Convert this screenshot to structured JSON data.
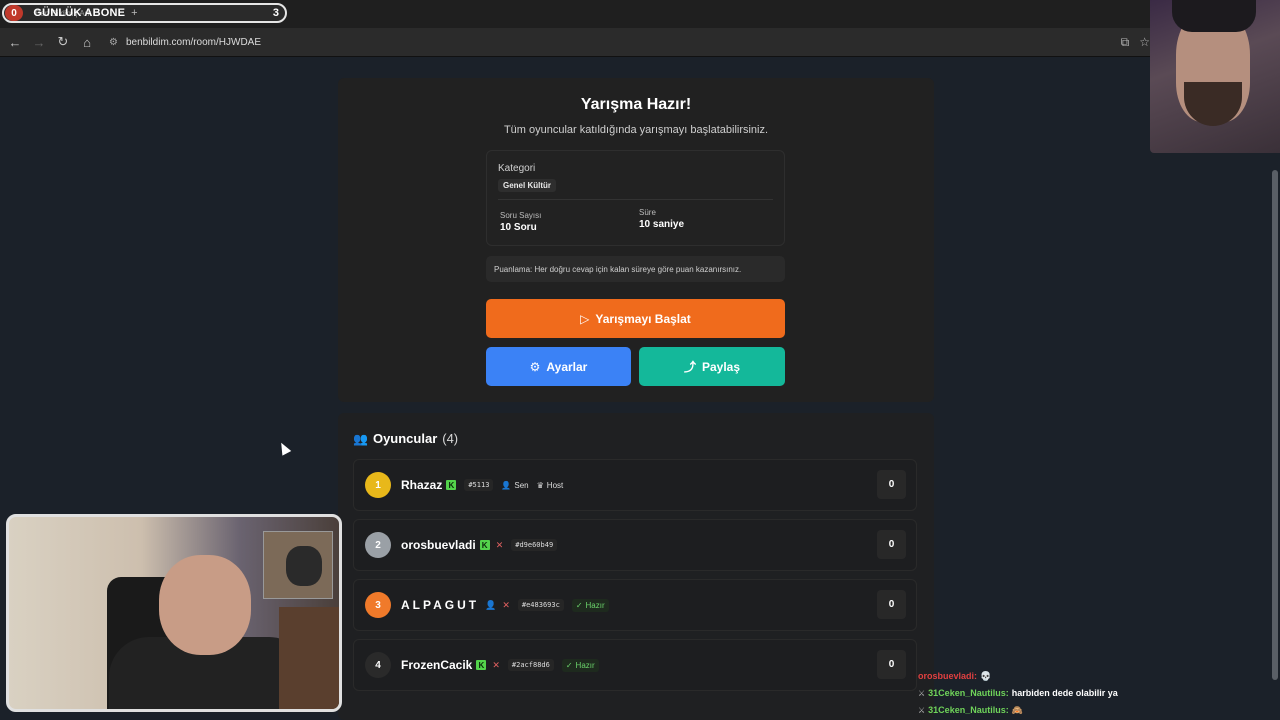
{
  "browser": {
    "tab_title": "Ben Bildim | Ark",
    "counter_left": "0",
    "counter_label": "GÜNLÜK ABONE",
    "counter_plus": "+",
    "counter_right": "3",
    "url": "benbildim.com/room/HJWDAE"
  },
  "ready": {
    "title": "Yarışma Hazır!",
    "subtitle": "Tüm oyuncular katıldığında yarışmayı başlatabilirsiniz.",
    "category_label": "Kategori",
    "category_value": "Genel Kültür",
    "questions_label": "Soru Sayısı",
    "questions_value": "10 Soru",
    "time_label": "Süre",
    "time_value": "10 saniye",
    "note": "Puanlama: Her doğru cevap için kalan süreye göre puan kazanırsınız.",
    "start_label": "Yarışmayı Başlat",
    "settings_label": "Ayarlar",
    "share_label": "Paylaş"
  },
  "players": {
    "title": "Oyuncular",
    "count": "(4)",
    "you_label": "Sen",
    "host_label": "Host",
    "ready_label": "Hazır",
    "list": [
      {
        "rank": "1",
        "name": "Rhazaz",
        "id": "#5113",
        "score": "0",
        "color": "#e8b81a"
      },
      {
        "rank": "2",
        "name": "orosbuevladi",
        "id": "#d9e60b49",
        "score": "0",
        "color": "#9aa0a6"
      },
      {
        "rank": "3",
        "name": "ALPAGUT",
        "id": "#e483693c",
        "score": "0",
        "color": "#f07a2a"
      },
      {
        "rank": "4",
        "name": "FrozenCacik",
        "id": "#2acf88d6",
        "score": "0",
        "color": "#2a2a2a"
      }
    ]
  },
  "chat": [
    {
      "user": "orosbuevladi:",
      "message": "💀"
    },
    {
      "user": "31Ceken_Nautilus:",
      "message": "harbiden dede olabilir ya"
    },
    {
      "user": "31Ceken_Nautilus:",
      "message": "🙈"
    }
  ]
}
